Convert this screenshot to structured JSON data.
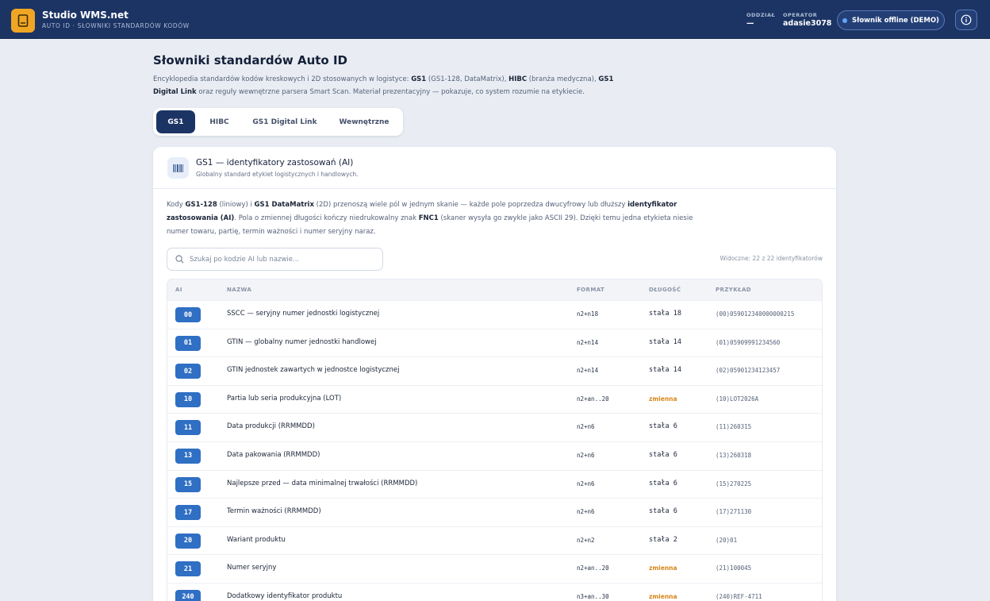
{
  "header": {
    "app_title": "Studio WMS.net",
    "app_subtitle": "AUTO ID · SŁOWNIKI STANDARDÓW KODÓW",
    "branch_label": "ODDZIAŁ",
    "branch_value": "—",
    "operator_label": "OPERATOR",
    "operator_value": "adasie3078",
    "offline_badge": "Słownik offline (DEMO)",
    "logo_icon": "book-icon",
    "info_icon": "info-icon",
    "accent_color": "#f0a624",
    "bar_color": "#1c3464"
  },
  "page": {
    "title": "Słowniki standardów Auto ID",
    "desc_1": "Encyklopedia standardów kodów kreskowych i 2D stosowanych w logistyce: ",
    "desc_gs1": "GS1",
    "desc_2": " (GS1-128, DataMatrix), ",
    "desc_hibc": "HIBC",
    "desc_3": " (branża medyczna), ",
    "desc_gs1dl": "GS1 Digital Link",
    "desc_4": " oraz reguły wewnętrzne parsera Smart Scan. Materiał prezentacyjny — pokazuje, co system rozumie na etykiecie."
  },
  "tabs": [
    {
      "label": "GS1",
      "active": true
    },
    {
      "label": "HIBC",
      "active": false
    },
    {
      "label": "GS1 Digital Link",
      "active": false
    },
    {
      "label": "Wewnętrzne",
      "active": false
    }
  ],
  "card": {
    "title": "GS1 — identyfikatory zastosowań (AI)",
    "subtitle": "Globalny standard etykiet logistycznych i handlowych.",
    "icon": "barcode-icon",
    "intro_1": "Kody ",
    "intro_gs1128": "GS1-128",
    "intro_2": " (liniowy) i ",
    "intro_dm": "GS1 DataMatrix",
    "intro_3": " (2D) przenoszą wiele pól w jednym skanie — każde pole poprzedza dwucyfrowy lub dłuższy ",
    "intro_ai": "identyfikator zastosowania (AI)",
    "intro_4": ". Pola o zmiennej długości kończy niedrukowalny znak ",
    "intro_fnc1": "FNC1",
    "intro_5": " (skaner wysyła go zwykle jako ASCII 29). Dzięki temu jedna etykieta niesie numer towaru, partię, termin ważności i numer seryjny naraz.",
    "search_placeholder": "Szukaj po kodzie AI lub nazwie...",
    "search_icon": "search-icon",
    "visible_count": "Widoczne: 22 z 22 identyfikatorów"
  },
  "table": {
    "columns": {
      "ai": "AI",
      "name": "NAZWA",
      "format": "FORMAT",
      "length": "DŁUGOŚĆ",
      "example": "PRZYKŁAD"
    },
    "variable_color": "#d8861a",
    "badge_color": "#2f6fc4",
    "rows": [
      {
        "ai": "00",
        "name": "SSCC — seryjny numer jednostki logistycznej",
        "format": "n2+n18",
        "length": "stała 18",
        "variable": false,
        "example": "(00)059012340000000215"
      },
      {
        "ai": "01",
        "name": "GTIN — globalny numer jednostki handlowej",
        "format": "n2+n14",
        "length": "stała 14",
        "variable": false,
        "example": "(01)05909991234560"
      },
      {
        "ai": "02",
        "name": "GTIN jednostek zawartych w jednostce logistycznej",
        "format": "n2+n14",
        "length": "stała 14",
        "variable": false,
        "example": "(02)05901234123457"
      },
      {
        "ai": "10",
        "name": "Partia lub seria produkcyjna (LOT)",
        "format": "n2+an..20",
        "length": "zmienna",
        "variable": true,
        "example": "(10)LOT2026A"
      },
      {
        "ai": "11",
        "name": "Data produkcji (RRMMDD)",
        "format": "n2+n6",
        "length": "stała 6",
        "variable": false,
        "example": "(11)260315"
      },
      {
        "ai": "13",
        "name": "Data pakowania (RRMMDD)",
        "format": "n2+n6",
        "length": "stała 6",
        "variable": false,
        "example": "(13)260318"
      },
      {
        "ai": "15",
        "name": "Najlepsze przed — data minimalnej trwałości (RRMMDD)",
        "format": "n2+n6",
        "length": "stała 6",
        "variable": false,
        "example": "(15)270225"
      },
      {
        "ai": "17",
        "name": "Termin ważności (RRMMDD)",
        "format": "n2+n6",
        "length": "stała 6",
        "variable": false,
        "example": "(17)271130"
      },
      {
        "ai": "20",
        "name": "Wariant produktu",
        "format": "n2+n2",
        "length": "stała 2",
        "variable": false,
        "example": "(20)01"
      },
      {
        "ai": "21",
        "name": "Numer seryjny",
        "format": "n2+an..20",
        "length": "zmienna",
        "variable": true,
        "example": "(21)100045"
      },
      {
        "ai": "240",
        "name": "Dodatkowy identyfikator produktu",
        "format": "n3+an..30",
        "length": "zmienna",
        "variable": true,
        "example": "(240)REF-4711"
      }
    ]
  }
}
